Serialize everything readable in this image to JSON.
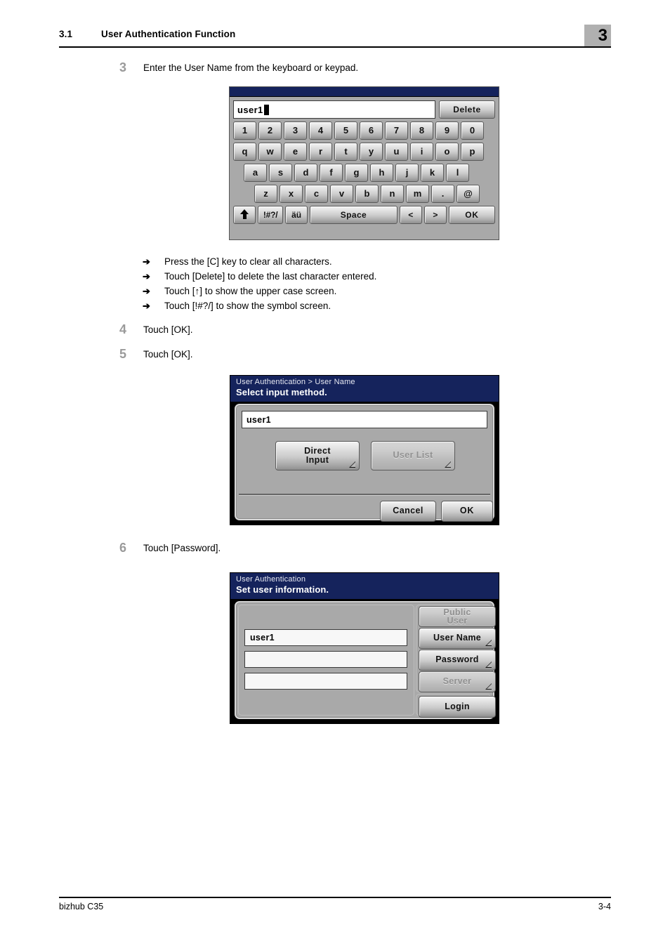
{
  "header": {
    "section_number": "3.1",
    "section_title": "User Authentication Function",
    "chapter_badge": "3"
  },
  "steps": [
    {
      "number": "3",
      "text": "Enter the User Name from the keyboard or keypad."
    },
    {
      "number": "4",
      "text": "Touch [OK]."
    },
    {
      "number": "5",
      "text": "Touch [OK]."
    },
    {
      "number": "6",
      "text": "Touch [Password]."
    }
  ],
  "bullets": [
    {
      "arrow": "➔",
      "text": "Press the [C] key to clear all characters."
    },
    {
      "arrow": "➔",
      "text": "Touch [Delete] to delete the last character entered."
    },
    {
      "arrow": "➔",
      "text": "Touch [↑] to show the upper case screen."
    },
    {
      "arrow": "➔",
      "text": "Touch [!#?/] to show the symbol screen."
    }
  ],
  "keyboard_screen": {
    "input_value": "user1",
    "delete_label": "Delete",
    "row_numbers": [
      "1",
      "2",
      "3",
      "4",
      "5",
      "6",
      "7",
      "8",
      "9",
      "0"
    ],
    "row_qwerty": [
      "q",
      "w",
      "e",
      "r",
      "t",
      "y",
      "u",
      "i",
      "o",
      "p"
    ],
    "row_asdf": [
      "a",
      "s",
      "d",
      "f",
      "g",
      "h",
      "j",
      "k",
      "l"
    ],
    "row_zxcv": [
      "z",
      "x",
      "c",
      "v",
      "b",
      "n",
      "m",
      ".",
      "@"
    ],
    "function_row": {
      "shift_label": "",
      "symbol_label": "!#?/",
      "accent_label": "äü",
      "space_label": "Space",
      "left_label": "<",
      "right_label": ">",
      "ok_label": "OK"
    }
  },
  "dialog_input_method": {
    "breadcrumb": "User Authentication > User Name",
    "title": "Select input method.",
    "name_value": "user1",
    "direct_input_line1": "Direct",
    "direct_input_line2": "Input",
    "user_list_label": "User List",
    "cancel_label": "Cancel",
    "ok_label": "OK"
  },
  "dialog_user_info": {
    "breadcrumb": "User Authentication",
    "title": "Set user information.",
    "field_username": "user1",
    "field_password": "",
    "field_server": "",
    "public_user_line1": "Public",
    "public_user_line2": "User",
    "user_name_label": "User Name",
    "password_label": "Password",
    "server_label": "Server",
    "login_label": "Login"
  },
  "footer": {
    "product": "bizhub C35",
    "page_number": "3-4"
  }
}
